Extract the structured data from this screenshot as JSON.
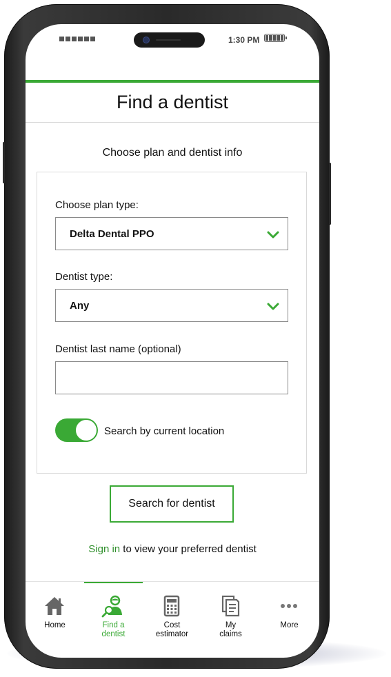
{
  "status_bar": {
    "time": "1:30 PM"
  },
  "page_title": "Find a dentist",
  "subtitle": "Choose plan and dentist info",
  "form": {
    "plan_type_label": "Choose plan type:",
    "plan_type_value": "Delta Dental PPO",
    "dentist_type_label": "Dentist type:",
    "dentist_type_value": "Any",
    "last_name_label": "Dentist last name (optional)",
    "last_name_value": "",
    "location_toggle_label": "Search by current location",
    "location_toggle_on": true
  },
  "search_button_label": "Search for dentist",
  "sign_in": {
    "link": "Sign in",
    "rest": " to view your preferred dentist"
  },
  "tabs": [
    {
      "line1": "Home",
      "line2": "",
      "icon": "home-icon"
    },
    {
      "line1": "Find a",
      "line2": "dentist",
      "icon": "find-dentist-icon",
      "active": true
    },
    {
      "line1": "Cost",
      "line2": "estimator",
      "icon": "calculator-icon"
    },
    {
      "line1": "My",
      "line2": "claims",
      "icon": "claims-icon"
    },
    {
      "line1": "More",
      "line2": "",
      "icon": "more-icon"
    }
  ],
  "colors": {
    "accent": "#3aa935",
    "link": "#2f8f2b",
    "text": "#111111",
    "border": "#8a8a8a"
  }
}
